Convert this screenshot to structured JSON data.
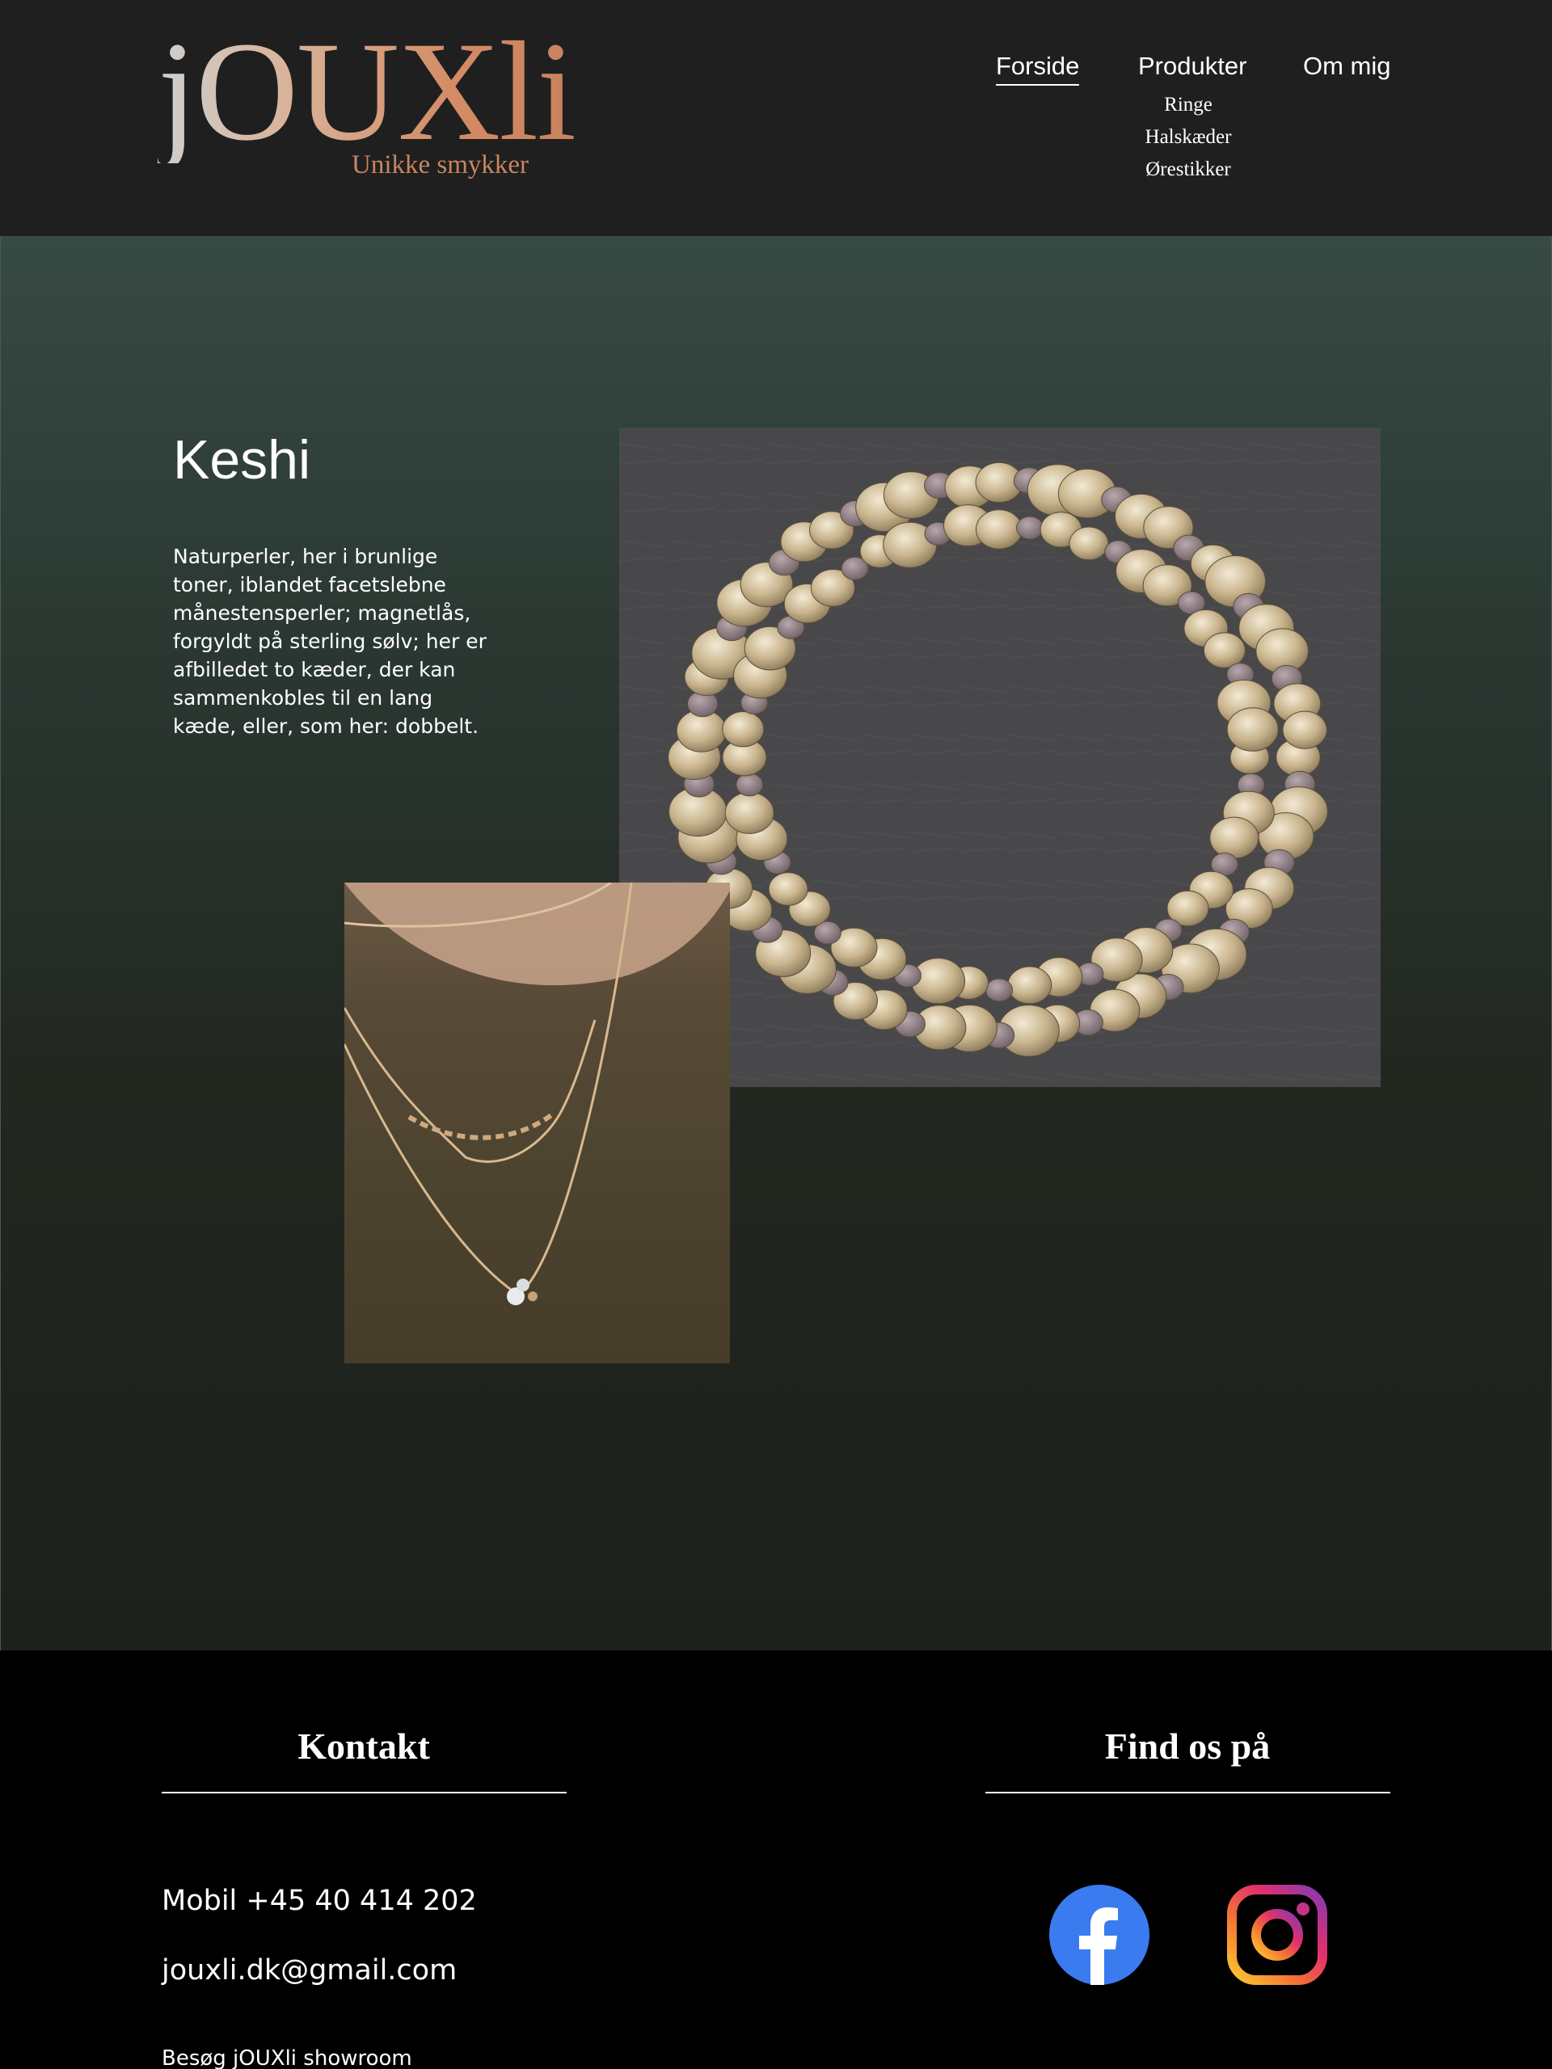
{
  "header": {
    "logo_word": "jOUXli",
    "logo_tagline": "Unikke smykker",
    "nav": {
      "home": "Forside",
      "products": "Produkter",
      "about": "Om mig"
    },
    "products_submenu": [
      "Ringe",
      "Halskæder",
      "Ørestikker"
    ]
  },
  "main": {
    "title": "Keshi",
    "description": "Naturperler, her i brunlige toner, iblandet facetslebne månestensperler; magnetlås, forgyldt på sterling sølv; her er afbilledet to kæder, der kan sammenkobles til en lang kæde, eller, som her: dobbelt."
  },
  "footer": {
    "contact_heading": "Kontakt",
    "social_heading": "Find os på",
    "phone": "Mobil +45 40 414 202",
    "email": "jouxli.dk@gmail.com",
    "showroom": "Besøg jOUXli showroom",
    "social_icons": [
      "facebook-icon",
      "instagram-icon"
    ]
  },
  "colors": {
    "header_bg": "#1f1f1f",
    "main_bg_top": "#374a43",
    "main_bg_bottom": "#1e201b",
    "footer_bg": "#000000",
    "logo_copper": "#c88560",
    "facebook_blue": "#3b7bf0"
  }
}
